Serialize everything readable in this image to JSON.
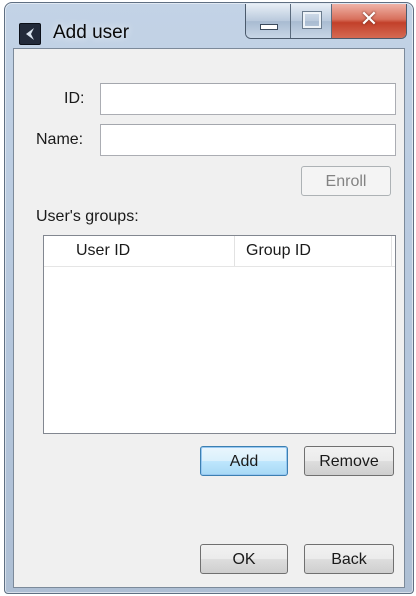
{
  "window": {
    "title": "Add user"
  },
  "form": {
    "id_label": "ID:",
    "id_value": "",
    "name_label": "Name:",
    "name_value": "",
    "enroll_label": "Enroll",
    "groups_label": "User's groups:"
  },
  "groups_table": {
    "columns": [
      "User ID",
      "Group ID"
    ],
    "rows": []
  },
  "actions": {
    "add_label": "Add",
    "remove_label": "Remove",
    "ok_label": "OK",
    "back_label": "Back"
  }
}
